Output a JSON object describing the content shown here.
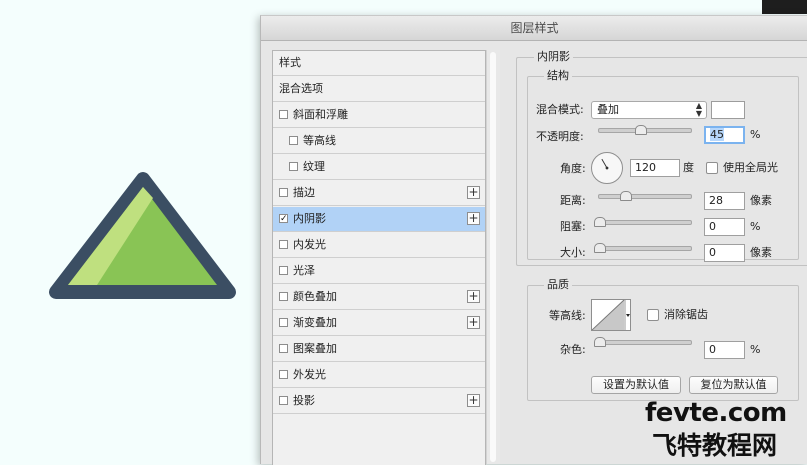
{
  "dialog": {
    "title": "图层样式"
  },
  "style_list": {
    "header": "样式",
    "blending": "混合选项",
    "items": [
      {
        "label": "斜面和浮雕",
        "checked": false,
        "plus": false,
        "indent": 0
      },
      {
        "label": "等高线",
        "checked": false,
        "plus": false,
        "indent": 1
      },
      {
        "label": "纹理",
        "checked": false,
        "plus": false,
        "indent": 1
      },
      {
        "label": "描边",
        "checked": false,
        "plus": true,
        "indent": 0
      },
      {
        "label": "内阴影",
        "checked": true,
        "plus": true,
        "indent": 0,
        "active": true
      },
      {
        "label": "内发光",
        "checked": false,
        "plus": false,
        "indent": 0
      },
      {
        "label": "光泽",
        "checked": false,
        "plus": false,
        "indent": 0
      },
      {
        "label": "颜色叠加",
        "checked": false,
        "plus": true,
        "indent": 0
      },
      {
        "label": "渐变叠加",
        "checked": false,
        "plus": true,
        "indent": 0
      },
      {
        "label": "图案叠加",
        "checked": false,
        "plus": false,
        "indent": 0
      },
      {
        "label": "外发光",
        "checked": false,
        "plus": false,
        "indent": 0
      },
      {
        "label": "投影",
        "checked": false,
        "plus": true,
        "indent": 0
      }
    ],
    "check_mark": "✓",
    "plus_mark": "+"
  },
  "inner_shadow": {
    "section_title": "内阴影",
    "structure": {
      "legend": "结构",
      "blend_mode_label": "混合模式:",
      "blend_mode_value": "叠加",
      "swatch_color": "#ffffff",
      "opacity_label": "不透明度:",
      "opacity_value": "45",
      "opacity_fraction": 0.45,
      "opacity_unit": "%",
      "angle_label": "角度:",
      "angle_value": "120",
      "angle_unit": "度",
      "global_light_label": "使用全局光",
      "global_light_checked": false,
      "distance_label": "距离:",
      "distance_value": "28",
      "distance_fraction": 0.28,
      "distance_unit": "像素",
      "choke_label": "阻塞:",
      "choke_value": "0",
      "choke_fraction": 0,
      "choke_unit": "%",
      "size_label": "大小:",
      "size_value": "0",
      "size_fraction": 0,
      "size_unit": "像素"
    },
    "quality": {
      "legend": "品质",
      "contour_label": "等高线:",
      "anti_alias_label": "消除锯齿",
      "anti_alias_checked": false,
      "noise_label": "杂色:",
      "noise_value": "0",
      "noise_fraction": 0,
      "noise_unit": "%"
    },
    "buttons": {
      "make_default": "设置为默认值",
      "reset_default": "复位为默认值"
    }
  },
  "canvas": {
    "triangle_outer_color": "#3b4e63",
    "triangle_fill_color": "#89c455",
    "triangle_highlight_color": "#bfe07f"
  },
  "watermark": {
    "line1": "fevte.com",
    "line2": "飞特教程网"
  }
}
